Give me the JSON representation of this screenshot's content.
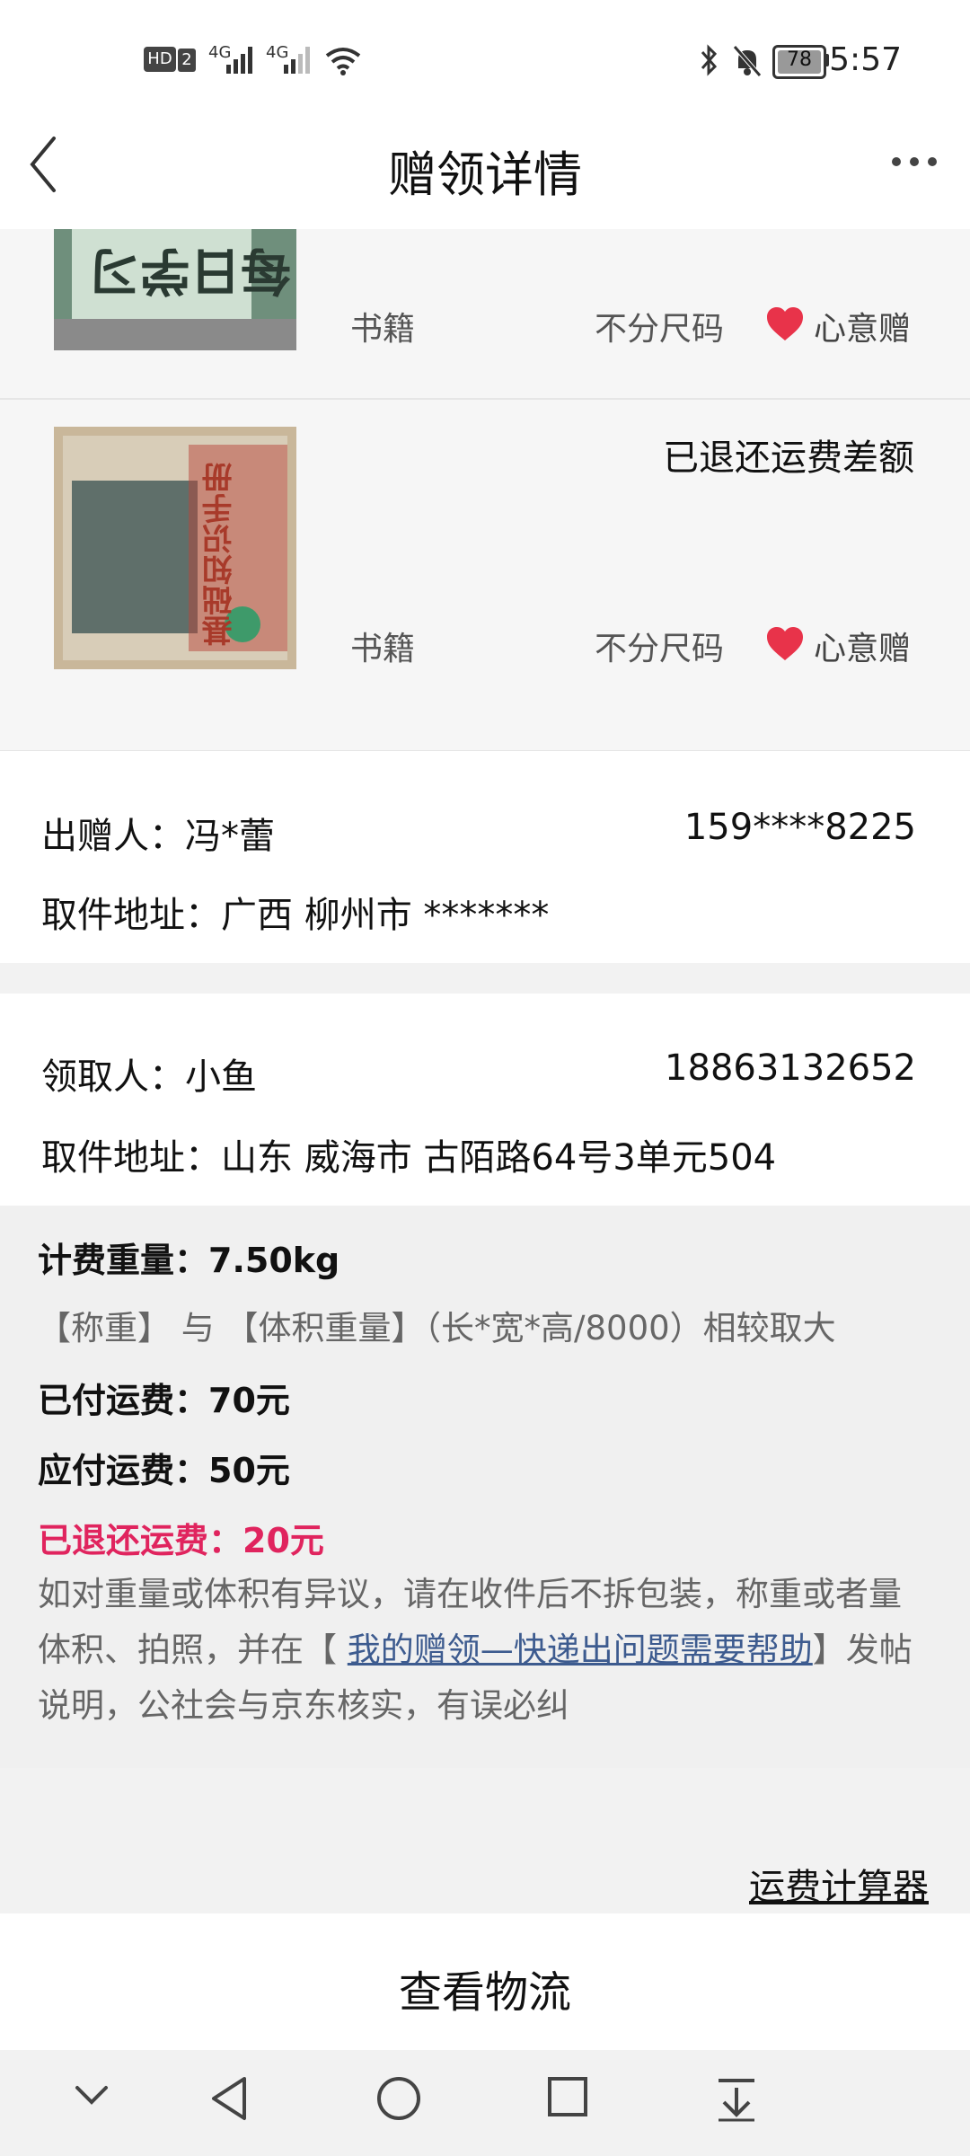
{
  "status_bar": {
    "network_badge": "HD",
    "sim_slot": "2",
    "signal1": "4G",
    "signal2": "4G",
    "battery": "78",
    "time": "5:57",
    "icons": [
      "bluetooth-icon",
      "mute-icon",
      "battery-icon",
      "wifi-icon",
      "signal-icon"
    ]
  },
  "header": {
    "title": "赠领详情",
    "back_icon": "chevron-left-icon",
    "more_icon": "more-dots-icon"
  },
  "items": [
    {
      "category": "书籍",
      "size": "不分尺码",
      "tag": "心意赠",
      "thumb_text": "每日学习",
      "status": ""
    },
    {
      "category": "书籍",
      "size": "不分尺码",
      "tag": "心意赠",
      "thumb_text": "基础知识手册",
      "status": "已退还运费差额"
    }
  ],
  "giver": {
    "label": "出赠人：",
    "name": "冯*蕾",
    "phone": "159****8225",
    "addr_label": "取件地址：",
    "address": "广西 柳州市 *******"
  },
  "receiver": {
    "label": "领取人：",
    "name": "小鱼",
    "phone": "18863132652",
    "addr_label": "取件地址：",
    "address": "山东 威海市 古陌路64号3单元504"
  },
  "fee": {
    "weight_line": "计费重量：7.50kg",
    "rule_line": "【称重】 与 【体积重量】（长*宽*高/8000）相较取大",
    "paid_line": "已付运费：70元",
    "due_line": "应付运费：50元",
    "refund_line": "已退还运费：20元",
    "note_before": "如对重量或体积有异议，请在收件后不拆包装，称重或者量体积、拍照，并在【 ",
    "note_link": "我的赠领—快递出问题需要帮助",
    "note_after": "】发帖说明，公社会与京东核实，有误必纠"
  },
  "calculator_link": "运费计算器",
  "bottom_button": "查看物流",
  "colors": {
    "accent_red": "#e0245e",
    "link_blue": "#3d5b8f",
    "heart": "#e8334a"
  }
}
